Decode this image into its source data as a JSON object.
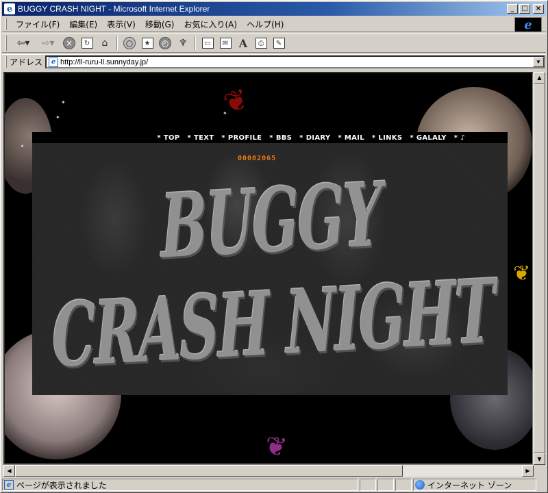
{
  "window": {
    "title": "BUGGY CRASH NIGHT - Microsoft Internet Explorer",
    "controls": {
      "minimize": "_",
      "maximize": "□",
      "close": "×"
    }
  },
  "menu": {
    "items": [
      "ファイル(F)",
      "編集(E)",
      "表示(V)",
      "移動(G)",
      "お気に入り(A)",
      "ヘルプ(H)"
    ]
  },
  "toolbar": {
    "icons": [
      "back-icon",
      "forward-icon",
      "stop-icon",
      "refresh-icon",
      "home-icon",
      "search-icon",
      "favorites-icon",
      "history-icon",
      "channels-icon",
      "fullscreen-icon",
      "mail-icon",
      "font-icon",
      "print-icon",
      "edit-icon"
    ]
  },
  "address": {
    "label": "アドレス",
    "url": "http://ll-ruru-ll.sunnyday.jp/"
  },
  "page": {
    "nav": [
      {
        "star": "*",
        "label": "TOP"
      },
      {
        "star": "*",
        "label": "TEXT"
      },
      {
        "star": "*",
        "label": "PROFILE"
      },
      {
        "star": "*",
        "label": "BBS"
      },
      {
        "star": "*",
        "label": "DIARY"
      },
      {
        "star": "*",
        "label": "MAIL"
      },
      {
        "star": "*",
        "label": "LINKS"
      },
      {
        "star": "*",
        "label": "GALALY"
      },
      {
        "star": "*",
        "label": "♪"
      }
    ],
    "counter": "00002065",
    "logo_text": "BUGGY CRASH NIGHT"
  },
  "status": {
    "message": "ページが表示されました",
    "zone": "インターネット ゾーン"
  },
  "colors": {
    "titlebar_start": "#0a246a",
    "counter": "#f07a10",
    "butterfly_red": "#8b0a0a",
    "butterfly_purple": "#8e2f86",
    "butterfly_yellow": "#d7a800"
  }
}
